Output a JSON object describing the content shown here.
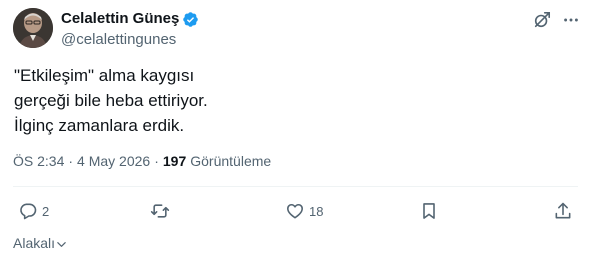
{
  "author": {
    "display_name": "Celalettin Güneş",
    "handle": "@celalettingunes",
    "verified": true
  },
  "tweet": {
    "lines": [
      "\"Etkileşim\" alma kaygısı",
      "gerçeği bile heba ettiriyor.",
      "İlginç zamanlara erdik."
    ]
  },
  "meta": {
    "time": "ÖS 2:34",
    "separator": "·",
    "date": "4 May 2026",
    "views_count": "197",
    "views_label": "Görüntüleme"
  },
  "actions": {
    "reply_count": "2",
    "retweet_count": "",
    "like_count": "18"
  },
  "sort": {
    "label": "Alakalı"
  },
  "colors": {
    "verified": "#1d9bf0",
    "icon": "#536471",
    "text": "#0f1419"
  },
  "icons": [
    "verified-badge-icon",
    "grok-icon",
    "more-icon",
    "reply-icon",
    "retweet-icon",
    "like-icon",
    "bookmark-icon",
    "share-icon",
    "chevron-down-icon"
  ]
}
